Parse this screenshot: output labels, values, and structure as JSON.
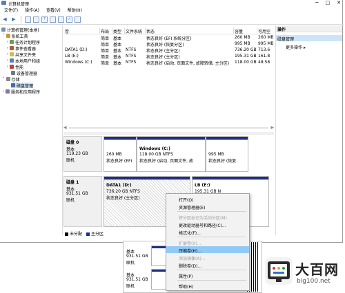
{
  "window": {
    "title": "计算机管理",
    "controls": [
      "─",
      "□",
      "✕"
    ]
  },
  "menubar": [
    "文件(F)",
    "操作(A)",
    "查看(V)",
    "帮助(H)"
  ],
  "tree": {
    "root": "计算机管理(本地)",
    "items": [
      "系统工具",
      "任务计划程序",
      "事件查看器",
      "共享文件夹",
      "本地用户和组",
      "性能",
      "设备管理器",
      "存储",
      "磁盘管理",
      "服务和应用程序"
    ]
  },
  "volume_table": {
    "headers": [
      "卷",
      "布局",
      "类型",
      "文件系统",
      "状态",
      "容量",
      "可用空"
    ],
    "rows": [
      [
        "",
        "简单",
        "基本",
        "",
        "状态良好 (EFI 系统分区)",
        "260 MB",
        "260 MB"
      ],
      [
        "",
        "简单",
        "基本",
        "",
        "状态良好 (恢复分区)",
        "995 MB",
        "995 MB"
      ],
      [
        "DATA1 (D:)",
        "简单",
        "基本",
        "NTFS",
        "状态良好 (主分区)",
        "736.20 GB",
        "713.6"
      ],
      [
        "LB (E:)",
        "简单",
        "基本",
        "NTFS",
        "状态良好 (主分区)",
        "195.31 GB",
        "161.8"
      ],
      [
        "Windows (C:)",
        "简单",
        "基本",
        "NTFS",
        "状态良好 (启动, 页面文件, 故障转储, 主分区)",
        "118.00 GB",
        "48.58"
      ]
    ]
  },
  "disks": {
    "disk0": {
      "name": "磁盘 0",
      "type": "基本",
      "size": "119.23 GB",
      "status": "联机",
      "p1": {
        "size": "260 MB",
        "status": "状态良好 (EFI"
      },
      "p2": {
        "name": "Windows (C:)",
        "size": "118.00 GB NTFS",
        "status": "状态良好 (启动, 页面文件, 故"
      },
      "p3": {
        "size": "995 MB",
        "status": "状态良好 (恢复"
      }
    },
    "disk1": {
      "name": "磁盘 1",
      "type": "基本",
      "size": "931.51 GB",
      "status": "联机",
      "p1": {
        "name": "DATA1 (D:)",
        "size": "736.20 GB NTFS",
        "status": "状态良好 (主分区)"
      },
      "p2": {
        "name": "LB (E:)",
        "size": "195.31 GB N"
      }
    }
  },
  "legend": {
    "unallocated": "未分配",
    "primary": "主分区"
  },
  "actions": {
    "header": "操作",
    "selected": "磁盘管理",
    "more": "更多操作"
  },
  "context_menu": [
    "打开(O)",
    "资源管理器(E)",
    "将分区标记为活动分区(M)",
    "更改驱动器号和路径(C)...",
    "格式化(F)...",
    "扩展卷(X)...",
    "压缩卷(H)...",
    "添加镜像(A)...",
    "删除卷(D)...",
    "属性(P)",
    "帮助(H)"
  ],
  "background_window": {
    "rows": [
      [
        "基本",
        "931.51 GB",
        "联机"
      ],
      [
        "基本",
        "931.51 GB",
        "联机"
      ]
    ]
  },
  "watermark": {
    "text": "大百网",
    "url": "big100.net"
  },
  "colors": {
    "primary_partition": "#1f2e88",
    "selection": "#cde3f7",
    "menu_highlight": "#91c9f7"
  }
}
